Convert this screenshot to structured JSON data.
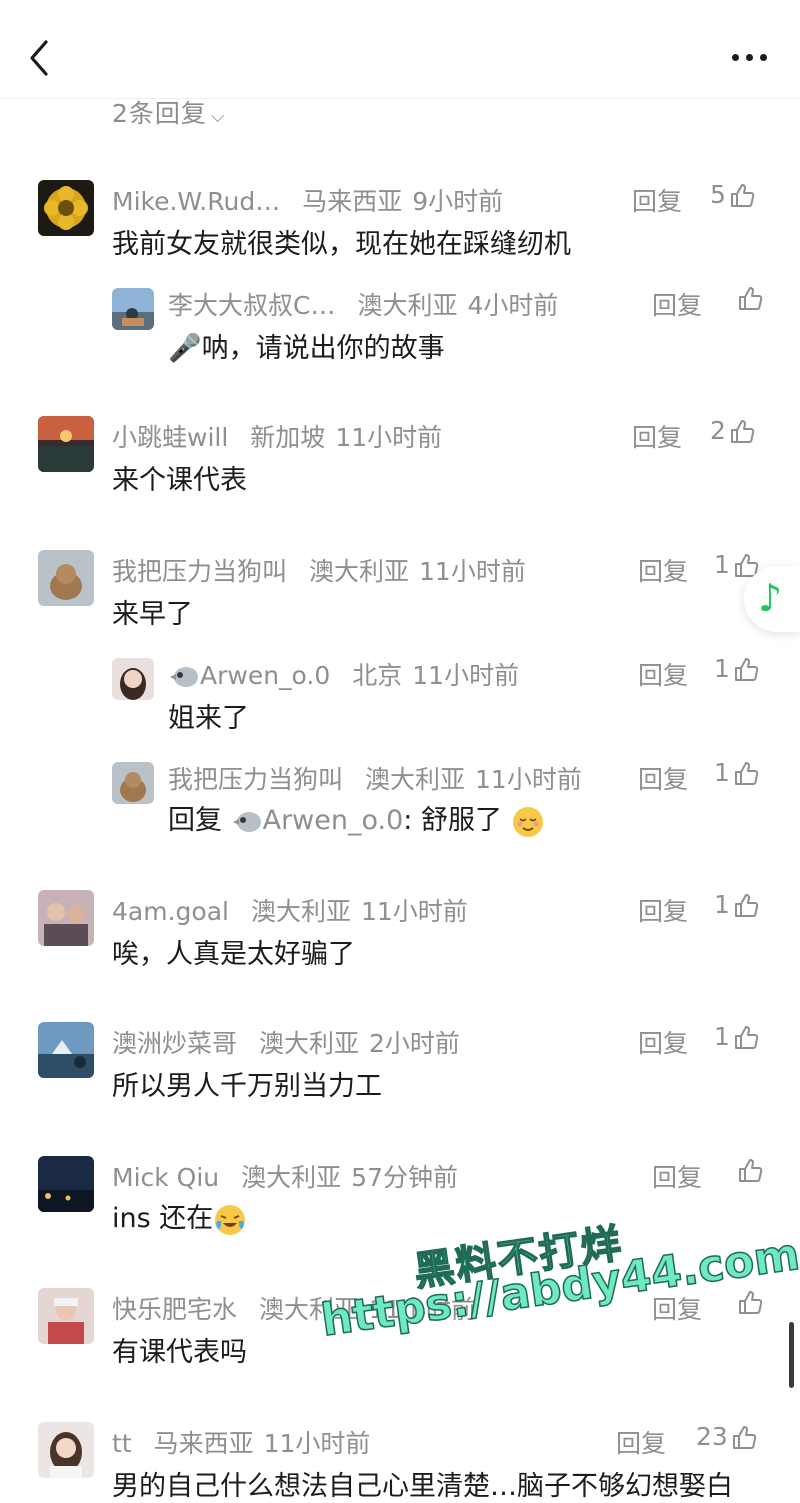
{
  "header": {
    "back_icon": "back-chevron-icon",
    "more_icon": "more-dots-icon"
  },
  "collapse_replies": {
    "label": "2条回复",
    "icon": "chevron-down-icon"
  },
  "comments": [
    {
      "user": "Mike.W.Rud…",
      "location": "马来西亚",
      "time": "9小时前",
      "text": "我前女友就很类似，现在她在踩缝纫机",
      "reply_label": "回复",
      "likes": "5"
    },
    {
      "user": "李大大叔叔C…",
      "location": "澳大利亚",
      "time": "4小时前",
      "text_prefix": "🎤",
      "text": "呐，请说出你的故事",
      "reply_label": "回复",
      "likes": ""
    },
    {
      "user": "小跳蛙will",
      "location": "新加坡",
      "time": "11小时前",
      "text": "来个课代表",
      "reply_label": "回复",
      "likes": "2"
    },
    {
      "user": "我把压力当狗叫",
      "location": "澳大利亚",
      "time": "11小时前",
      "text": "来早了",
      "reply_label": "回复",
      "likes": "1"
    },
    {
      "user": "Arwen_o.0",
      "location": "北京",
      "time": "11小时前",
      "text": "姐来了",
      "reply_label": "回复",
      "likes": "1"
    },
    {
      "user": "我把压力当狗叫",
      "location": "澳大利亚",
      "time": "11小时前",
      "text_reply_word": "回复",
      "text_target": "Arwen_o.0",
      "text": ": 舒服了",
      "reply_label": "回复",
      "likes": "1"
    },
    {
      "user": "4am.goal",
      "location": "澳大利亚",
      "time": "11小时前",
      "text": "唉，人真是太好骗了",
      "reply_label": "回复",
      "likes": "1"
    },
    {
      "user": "澳洲炒菜哥",
      "location": "澳大利亚",
      "time": "2小时前",
      "text": "所以男人千万别当力工",
      "reply_label": "回复",
      "likes": "1"
    },
    {
      "user": "Mick Qiu",
      "location": "澳大利亚",
      "time": "57分钟前",
      "text": "ins 还在",
      "reply_label": "回复",
      "likes": ""
    },
    {
      "user": "快乐肥宅水",
      "location": "澳大利亚",
      "time": "11小时前",
      "text": "有课代表吗",
      "reply_label": "回复",
      "likes": ""
    },
    {
      "user": "tt",
      "location": "马来西亚",
      "time": "11小时前",
      "text": "男的自己什么想法自己心里清楚…脑子不够幻想娶白",
      "reply_label": "回复",
      "likes": "23"
    }
  ],
  "music_float": {
    "icon": "music-note-icon"
  },
  "watermark": {
    "line1": "黑料不打烊",
    "line2": "https://abdy44.com"
  },
  "colors": {
    "meta_gray": "#8f8f8f",
    "text": "#1c1c1c",
    "accent_green": "#22c55e",
    "watermark": "#6fe8c4"
  }
}
